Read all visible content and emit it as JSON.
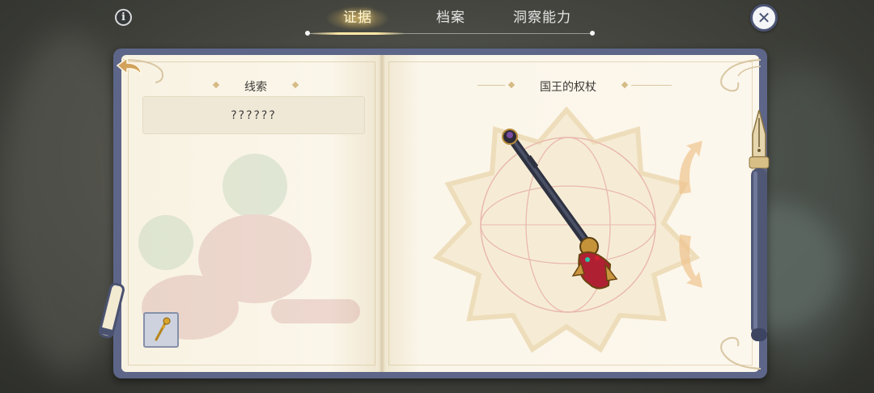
{
  "tabs": [
    {
      "label": "证据",
      "active": true
    },
    {
      "label": "档案",
      "active": false
    },
    {
      "label": "洞察能力",
      "active": false
    }
  ],
  "info_label": "i",
  "close_label": "✕",
  "left_page": {
    "section_title": "线索",
    "clue_text": "??????",
    "selected_item_icon": "scepter-icon"
  },
  "right_page": {
    "item_title": "国王的权杖",
    "item_icon": "scepter-icon"
  },
  "colors": {
    "book_frame": "#5d6688",
    "page": "#fbf6e9",
    "accent_gold": "#c99a55",
    "tab_active_glow": "#ffe9a6"
  }
}
